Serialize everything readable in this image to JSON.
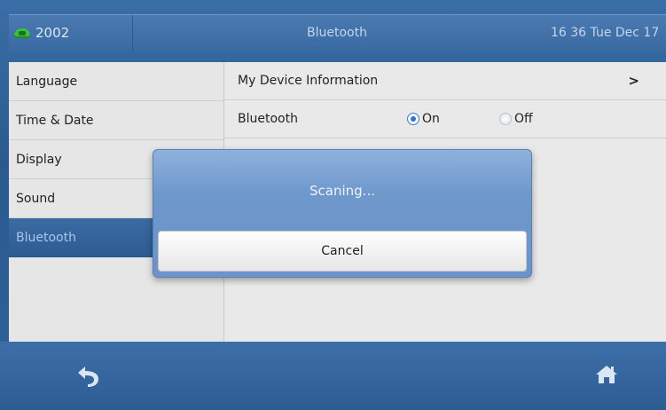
{
  "status_bar": {
    "extension": "2002",
    "title": "Bluetooth",
    "datetime": "16 36 Tue Dec 17",
    "phone_icon": "phone-icon"
  },
  "sidebar": {
    "items": [
      {
        "label": "Language"
      },
      {
        "label": "Time & Date"
      },
      {
        "label": "Display"
      },
      {
        "label": "Sound"
      },
      {
        "label": "Bluetooth",
        "active": true
      }
    ]
  },
  "main": {
    "rows": [
      {
        "label": "My Device Information",
        "chevron": ">"
      },
      {
        "label": "Bluetooth",
        "option_on": "On",
        "option_off": "Off",
        "selected": "On"
      }
    ]
  },
  "dialog": {
    "message": "Scaning...",
    "cancel_label": "Cancel"
  },
  "bottom_bar": {
    "back_icon": "back-arrow-icon",
    "home_icon": "home-icon"
  },
  "colors": {
    "accent_blue": "#2e5c92",
    "radio_selected": "#2a72d4",
    "status_green": "#36c23f"
  }
}
